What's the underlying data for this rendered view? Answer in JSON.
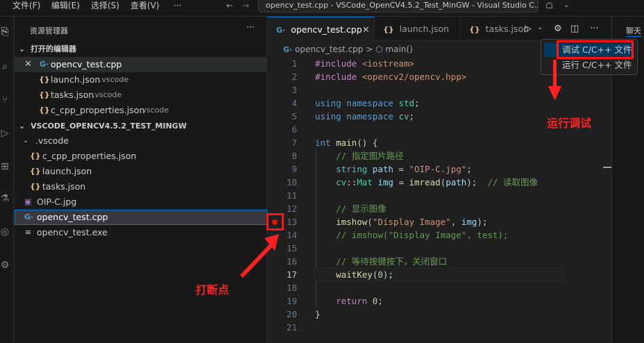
{
  "titlebar": {
    "menus": [
      "文件(F)",
      "编辑(E)",
      "选择(S)",
      "查看(V)",
      "···"
    ],
    "title": "opencv_test.cpp - VSCode_OpenCV4.5.2_Test_MinGW - Visual Studio C..."
  },
  "sidebar": {
    "title": "资源管理器",
    "more": "···",
    "open_editors_header": "打开的编辑器",
    "open_editors": [
      {
        "name": "opencv_test.cpp",
        "folder": "",
        "icon": "cpp-icon"
      },
      {
        "name": "launch.json",
        "folder": ".vscode",
        "icon": "json-icon"
      },
      {
        "name": "tasks.json",
        "folder": ".vscode",
        "icon": "json-icon"
      },
      {
        "name": "c_cpp_properties.json",
        "folder": ".vscode",
        "icon": "json-icon"
      }
    ],
    "workspace_header": "VSCODE_OPENCV4.5.2_TEST_MINGW",
    "tree": [
      {
        "name": ".vscode",
        "icon": "folder-icon"
      },
      {
        "name": "c_cpp_properties.json",
        "icon": "json-icon"
      },
      {
        "name": "launch.json",
        "icon": "json-icon"
      },
      {
        "name": "tasks.json",
        "icon": "json-icon"
      },
      {
        "name": "OIP-C.jpg",
        "icon": "image-icon"
      },
      {
        "name": "opencv_test.cpp",
        "icon": "cpp-icon"
      },
      {
        "name": "opencv_test.exe",
        "icon": "exe-icon"
      }
    ]
  },
  "tabs": [
    {
      "label": "opencv_test.cpp",
      "active": true
    },
    {
      "label": "launch.json",
      "active": false
    },
    {
      "label": "tasks.json",
      "active": false
    }
  ],
  "breadcrumb": {
    "file": "opencv_test.cpp",
    "symbol": "main()",
    "sep": ">"
  },
  "right_panel": {
    "chat_label": "聊天"
  },
  "run_menu": {
    "items": [
      "调试 C/C++ 文件",
      "运行 C/C++ 文件"
    ]
  },
  "annotations": {
    "run_debug": "运行调试",
    "breakpoint": "打断点"
  },
  "editor": {
    "current_line": 17,
    "breakpoint_line": 13,
    "lines": [
      {
        "n": "1",
        "tokens": [
          [
            "k",
            "#include"
          ],
          [
            "p",
            " "
          ],
          [
            "s",
            "<iostream>"
          ]
        ]
      },
      {
        "n": "2",
        "tokens": [
          [
            "k",
            "#include"
          ],
          [
            "p",
            " "
          ],
          [
            "s",
            "<opencv2/opencv.hpp>"
          ]
        ]
      },
      {
        "n": "3",
        "tokens": []
      },
      {
        "n": "4",
        "tokens": [
          [
            "kw",
            "using"
          ],
          [
            "p",
            " "
          ],
          [
            "kw",
            "namespace"
          ],
          [
            "p",
            " "
          ],
          [
            "ns",
            "std"
          ],
          [
            "p",
            ";"
          ]
        ]
      },
      {
        "n": "5",
        "tokens": [
          [
            "kw",
            "using"
          ],
          [
            "p",
            " "
          ],
          [
            "kw",
            "namespace"
          ],
          [
            "p",
            " "
          ],
          [
            "ns",
            "cv"
          ],
          [
            "p",
            ";"
          ]
        ]
      },
      {
        "n": "6",
        "tokens": []
      },
      {
        "n": "7",
        "tokens": [
          [
            "kw",
            "int"
          ],
          [
            "p",
            " "
          ],
          [
            "f",
            "main"
          ],
          [
            "p",
            "() {"
          ]
        ]
      },
      {
        "n": "8",
        "tokens": [
          [
            "p",
            "    "
          ],
          [
            "c",
            "// 指定图片路径"
          ]
        ]
      },
      {
        "n": "9",
        "tokens": [
          [
            "p",
            "    "
          ],
          [
            "t",
            "string"
          ],
          [
            "p",
            " "
          ],
          [
            "v",
            "path"
          ],
          [
            "p",
            " = "
          ],
          [
            "s",
            "\"OIP-C.jpg\""
          ],
          [
            "p",
            ";"
          ]
        ]
      },
      {
        "n": "10",
        "tokens": [
          [
            "p",
            "    "
          ],
          [
            "ns",
            "cv"
          ],
          [
            "p",
            "::"
          ],
          [
            "t",
            "Mat"
          ],
          [
            "p",
            " "
          ],
          [
            "v",
            "img"
          ],
          [
            "p",
            " = "
          ],
          [
            "f",
            "imread"
          ],
          [
            "p",
            "("
          ],
          [
            "v",
            "path"
          ],
          [
            "p",
            ");  "
          ],
          [
            "c",
            "// 读取图像"
          ]
        ]
      },
      {
        "n": "11",
        "tokens": []
      },
      {
        "n": "12",
        "tokens": [
          [
            "p",
            "    "
          ],
          [
            "c",
            "// 显示图像"
          ]
        ]
      },
      {
        "n": "13",
        "tokens": [
          [
            "p",
            "    "
          ],
          [
            "f",
            "imshow"
          ],
          [
            "p",
            "("
          ],
          [
            "s",
            "\"Display Image\""
          ],
          [
            "p",
            ", "
          ],
          [
            "v",
            "img"
          ],
          [
            "p",
            ");"
          ]
        ]
      },
      {
        "n": "14",
        "tokens": [
          [
            "p",
            "    "
          ],
          [
            "c",
            "// imshow(\"Display Image\", test);"
          ]
        ]
      },
      {
        "n": "15",
        "tokens": []
      },
      {
        "n": "16",
        "tokens": [
          [
            "p",
            "    "
          ],
          [
            "c",
            "// 等待按键按下，关闭窗口"
          ]
        ]
      },
      {
        "n": "17",
        "tokens": [
          [
            "p",
            "    "
          ],
          [
            "f",
            "waitKey"
          ],
          [
            "p",
            "("
          ],
          [
            "n",
            "0"
          ],
          [
            "p",
            ");"
          ]
        ]
      },
      {
        "n": "18",
        "tokens": []
      },
      {
        "n": "19",
        "tokens": [
          [
            "p",
            "    "
          ],
          [
            "k",
            "return"
          ],
          [
            "p",
            " "
          ],
          [
            "n",
            "0"
          ],
          [
            "p",
            ";"
          ]
        ]
      },
      {
        "n": "20",
        "tokens": [
          [
            "p",
            "}"
          ]
        ]
      },
      {
        "n": "21",
        "tokens": []
      }
    ]
  }
}
